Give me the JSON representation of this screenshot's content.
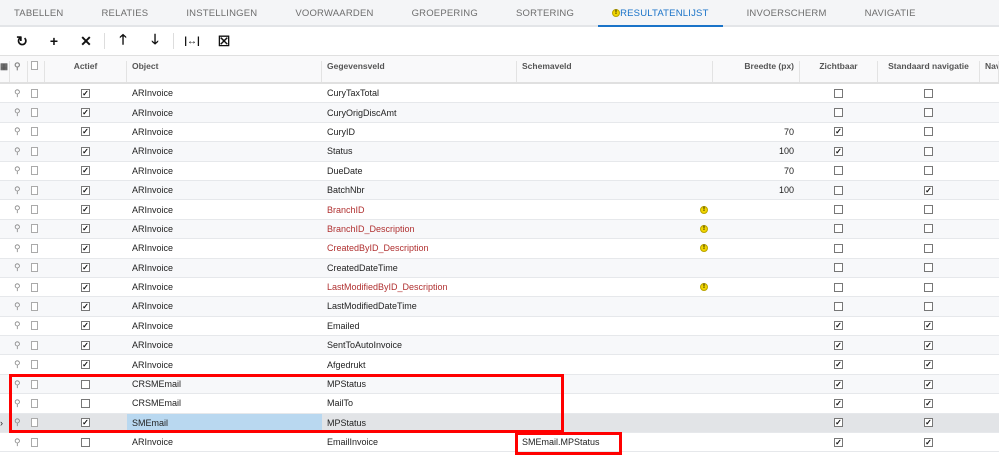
{
  "tabs": [
    "TABELLEN",
    "RELATIES",
    "INSTELLINGEN",
    "VOORWAARDEN",
    "GROEPERING",
    "SORTERING",
    "RESULTATENLIJST",
    "INVOERSCHERM",
    "NAVIGATIE"
  ],
  "active_tab": "RESULTATENLIJST",
  "toolbar": {
    "refresh": "↻",
    "add": "+",
    "delete": "✕",
    "up": "🡑",
    "down": "🡓",
    "fit": "|↔|",
    "export": "☒"
  },
  "columns": {
    "actief": "Actief",
    "object": "Object",
    "gegevensveld": "Gegevensveld",
    "schemaveld": "Schemaveld",
    "breedte": "Breedte (px)",
    "zichtbaar": "Zichtbaar",
    "standaard": "Standaard navigatie",
    "nav": "Nav"
  },
  "rows": [
    {
      "actief": true,
      "object": "ARInvoice",
      "field": "CuryTaxTotal",
      "schema": "",
      "width": "",
      "visible": false,
      "nav": false,
      "warn": false
    },
    {
      "actief": true,
      "object": "ARInvoice",
      "field": "CuryOrigDiscAmt",
      "schema": "",
      "width": "",
      "visible": false,
      "nav": false,
      "warn": false
    },
    {
      "actief": true,
      "object": "ARInvoice",
      "field": "CuryID",
      "schema": "",
      "width": "70",
      "visible": true,
      "nav": false,
      "warn": false
    },
    {
      "actief": true,
      "object": "ARInvoice",
      "field": "Status",
      "schema": "",
      "width": "100",
      "visible": true,
      "nav": false,
      "warn": false
    },
    {
      "actief": true,
      "object": "ARInvoice",
      "field": "DueDate",
      "schema": "",
      "width": "70",
      "visible": false,
      "nav": false,
      "warn": false
    },
    {
      "actief": true,
      "object": "ARInvoice",
      "field": "BatchNbr",
      "schema": "",
      "width": "100",
      "visible": false,
      "nav": true,
      "warn": false
    },
    {
      "actief": true,
      "object": "ARInvoice",
      "field": "BranchID",
      "schema": "",
      "width": "",
      "visible": false,
      "nav": false,
      "warn": true
    },
    {
      "actief": true,
      "object": "ARInvoice",
      "field": "BranchID_Description",
      "schema": "",
      "width": "",
      "visible": false,
      "nav": false,
      "warn": true
    },
    {
      "actief": true,
      "object": "ARInvoice",
      "field": "CreatedByID_Description",
      "schema": "",
      "width": "",
      "visible": false,
      "nav": false,
      "warn": true
    },
    {
      "actief": true,
      "object": "ARInvoice",
      "field": "CreatedDateTime",
      "schema": "",
      "width": "",
      "visible": false,
      "nav": false,
      "warn": false
    },
    {
      "actief": true,
      "object": "ARInvoice",
      "field": "LastModifiedByID_Description",
      "schema": "",
      "width": "",
      "visible": false,
      "nav": false,
      "warn": true
    },
    {
      "actief": true,
      "object": "ARInvoice",
      "field": "LastModifiedDateTime",
      "schema": "",
      "width": "",
      "visible": false,
      "nav": false,
      "warn": false
    },
    {
      "actief": true,
      "object": "ARInvoice",
      "field": "Emailed",
      "schema": "",
      "width": "",
      "visible": true,
      "nav": true,
      "warn": false
    },
    {
      "actief": true,
      "object": "ARInvoice",
      "field": "SentToAutoInvoice",
      "schema": "",
      "width": "",
      "visible": true,
      "nav": true,
      "warn": false
    },
    {
      "actief": true,
      "object": "ARInvoice",
      "field": "Afgedrukt",
      "schema": "",
      "width": "",
      "visible": true,
      "nav": true,
      "warn": false
    },
    {
      "actief": false,
      "object": "CRSMEmail",
      "field": "MPStatus",
      "schema": "",
      "width": "",
      "visible": true,
      "nav": true,
      "warn": false
    },
    {
      "actief": false,
      "object": "CRSMEmail",
      "field": "MailTo",
      "schema": "",
      "width": "",
      "visible": true,
      "nav": true,
      "warn": false
    },
    {
      "actief": true,
      "object": "SMEmail",
      "field": "MPStatus",
      "schema": "",
      "width": "",
      "visible": true,
      "nav": true,
      "warn": false,
      "selected": true
    },
    {
      "actief": false,
      "object": "ARInvoice",
      "field": "EmailInvoice",
      "schema": "SMEmail.MPStatus",
      "width": "",
      "visible": true,
      "nav": true,
      "warn": false
    }
  ]
}
